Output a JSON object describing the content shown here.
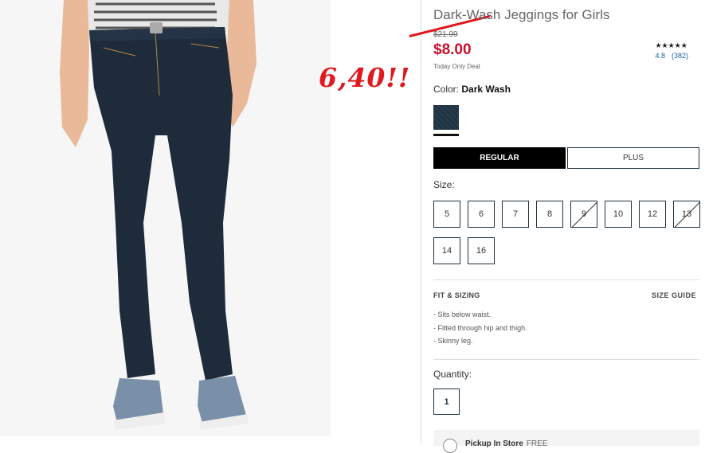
{
  "product": {
    "title": "Dark-Wash Jeggings for Girls",
    "original_price": "$21.99",
    "sale_price": "$8.00",
    "deal_note": "Today Only Deal",
    "annotation": "6,40!!"
  },
  "rating": {
    "stars": "★★★★★",
    "score": "4.8",
    "count": "(382)"
  },
  "color": {
    "label": "Color:",
    "value": "Dark Wash",
    "swatch_color": "#1f3342"
  },
  "fit": {
    "regular": "REGULAR",
    "plus": "PLUS"
  },
  "size": {
    "label": "Size:",
    "options": [
      {
        "label": "5",
        "available": true
      },
      {
        "label": "6",
        "available": true
      },
      {
        "label": "7",
        "available": true
      },
      {
        "label": "8",
        "available": true
      },
      {
        "label": "9",
        "available": false
      },
      {
        "label": "10",
        "available": true
      },
      {
        "label": "12",
        "available": true
      },
      {
        "label": "13",
        "available": false
      },
      {
        "label": "14",
        "available": true
      },
      {
        "label": "16",
        "available": true
      }
    ]
  },
  "fit_sizing": {
    "heading": "FIT & SIZING",
    "guide_link": "SIZE GUIDE",
    "bullets": [
      "- Sits below waist.",
      "- Fitted through hip and thigh.",
      "- Skinny leg."
    ]
  },
  "quantity": {
    "label": "Quantity:",
    "value": "1"
  },
  "pickup": {
    "label": "Pickup In Store",
    "free": "FREE"
  }
}
